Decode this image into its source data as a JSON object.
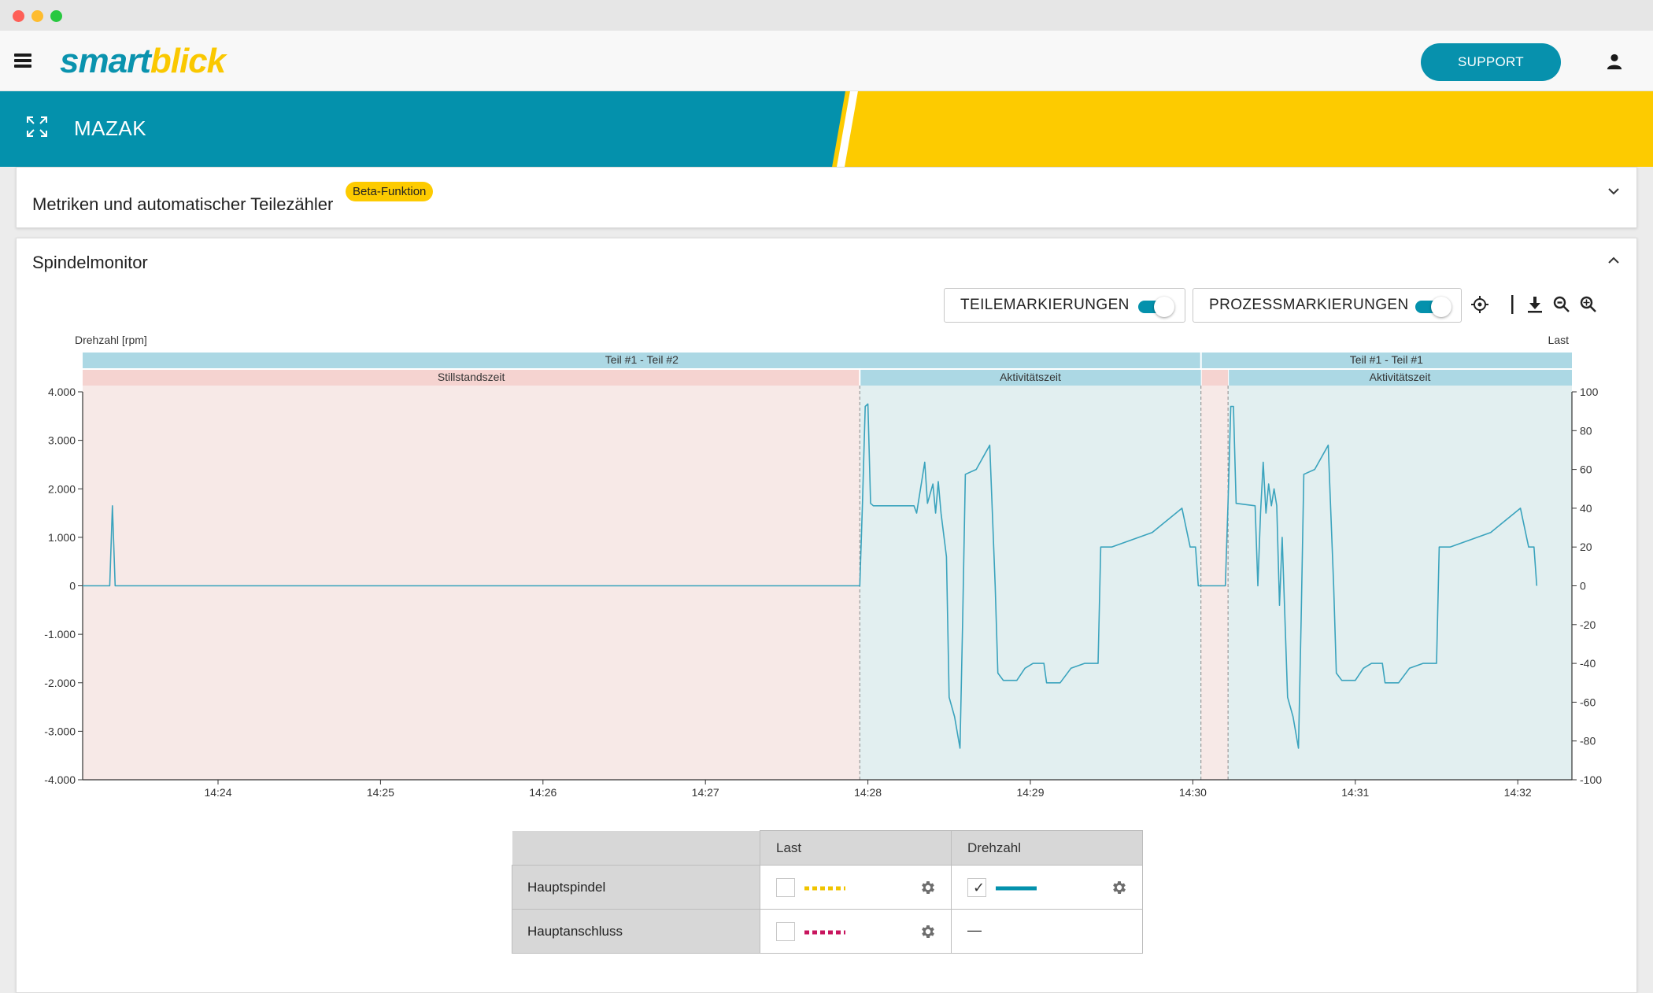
{
  "app": {
    "logo_part1": "smart",
    "logo_part2": "blick",
    "support_label": "SUPPORT",
    "machine_name": "MAZAK"
  },
  "metrics_card": {
    "title": "Metriken und automatischer Teilezähler",
    "badge": "Beta-Funktion"
  },
  "spindle_card": {
    "title": "Spindelmonitor",
    "toggle_parts": "TEILEMARKIERUNGEN",
    "toggle_process": "PROZESSMARKIERUNGEN"
  },
  "colors": {
    "teal": "#0491ac",
    "yellow": "#fdcb00",
    "idle_fill": "#f7e9e7",
    "active_fill": "#e2eff0",
    "part_band": "#acd8e4",
    "idle_band": "#f5d3d0",
    "series_line": "#3aa3bd",
    "load_main": "#f0c400",
    "load_conn": "#c8155e"
  },
  "chart_data": {
    "type": "line",
    "ylabel_left": "Drehzahl [rpm]",
    "ylabel_right": "Last",
    "y_left_ticks": [
      "4.000",
      "3.000",
      "2.000",
      "1.000",
      "0",
      "-1.000",
      "-2.000",
      "-3.000",
      "-4.000"
    ],
    "y_right_ticks": [
      "100",
      "80",
      "60",
      "40",
      "20",
      "0",
      "-20",
      "-40",
      "-60",
      "-80",
      "-100"
    ],
    "ylim_left": [
      -4000,
      4000
    ],
    "ylim_right": [
      -100,
      100
    ],
    "xlim": [
      "14:23:10",
      "14:32:20"
    ],
    "x_ticks": [
      "14:24",
      "14:25",
      "14:26",
      "14:27",
      "14:28",
      "14:29",
      "14:30",
      "14:31",
      "14:32"
    ],
    "part_bands": [
      {
        "label": "Teil #1 - Teil #2",
        "start": "14:23:10",
        "end": "14:30:03"
      },
      {
        "label": "Teil #1 - Teil #1",
        "start": "14:30:03",
        "end": "14:32:20"
      }
    ],
    "state_bands": [
      {
        "label": "Stillstandszeit",
        "state": "idle",
        "start": "14:23:10",
        "end": "14:27:57"
      },
      {
        "label": "Aktivitätszeit",
        "state": "active",
        "start": "14:27:57",
        "end": "14:30:03"
      },
      {
        "label": "",
        "state": "idle",
        "start": "14:30:03",
        "end": "14:30:13"
      },
      {
        "label": "Aktivitätszeit",
        "state": "active",
        "start": "14:30:13",
        "end": "14:32:20"
      }
    ],
    "series": [
      {
        "name": "Hauptspindel Drehzahl",
        "points": [
          [
            "14:23:10",
            0
          ],
          [
            "14:23:20",
            0
          ],
          [
            "14:23:21",
            1650
          ],
          [
            "14:23:22",
            0
          ],
          [
            "14:27:57",
            0
          ],
          [
            "14:27:58",
            1700
          ],
          [
            "14:27:59",
            3700
          ],
          [
            "14:28:00",
            3750
          ],
          [
            "14:28:01",
            1700
          ],
          [
            "14:28:02",
            1650
          ],
          [
            "14:28:17",
            1650
          ],
          [
            "14:28:18",
            1500
          ],
          [
            "14:28:20",
            2200
          ],
          [
            "14:28:21",
            2550
          ],
          [
            "14:28:22",
            1700
          ],
          [
            "14:28:24",
            2100
          ],
          [
            "14:28:25",
            1500
          ],
          [
            "14:28:26",
            2150
          ],
          [
            "14:28:27",
            1500
          ],
          [
            "14:28:29",
            600
          ],
          [
            "14:28:30",
            -2300
          ],
          [
            "14:28:32",
            -2700
          ],
          [
            "14:28:34",
            -3350
          ],
          [
            "14:28:35",
            -700
          ],
          [
            "14:28:36",
            2300
          ],
          [
            "14:28:40",
            2400
          ],
          [
            "14:28:45",
            2900
          ],
          [
            "14:28:47",
            0
          ],
          [
            "14:28:48",
            -1800
          ],
          [
            "14:28:50",
            -1950
          ],
          [
            "14:28:55",
            -1950
          ],
          [
            "14:28:58",
            -1700
          ],
          [
            "14:29:01",
            -1600
          ],
          [
            "14:29:05",
            -1600
          ],
          [
            "14:29:06",
            -2000
          ],
          [
            "14:29:11",
            -2000
          ],
          [
            "14:29:15",
            -1700
          ],
          [
            "14:29:20",
            -1600
          ],
          [
            "14:29:25",
            -1600
          ],
          [
            "14:29:26",
            800
          ],
          [
            "14:29:30",
            800
          ],
          [
            "14:29:45",
            1100
          ],
          [
            "14:29:56",
            1600
          ],
          [
            "14:29:59",
            800
          ],
          [
            "14:30:01",
            800
          ],
          [
            "14:30:02",
            0
          ],
          [
            "14:30:12",
            0
          ],
          [
            "14:30:13",
            1700
          ],
          [
            "14:30:14",
            3700
          ],
          [
            "14:30:15",
            3700
          ],
          [
            "14:30:16",
            1700
          ],
          [
            "14:30:23",
            1650
          ],
          [
            "14:30:24",
            0
          ],
          [
            "14:30:25",
            1500
          ],
          [
            "14:30:26",
            2550
          ],
          [
            "14:30:27",
            1500
          ],
          [
            "14:30:28",
            2100
          ],
          [
            "14:30:29",
            1650
          ],
          [
            "14:30:30",
            2000
          ],
          [
            "14:30:31",
            1650
          ],
          [
            "14:30:32",
            -400
          ],
          [
            "14:30:33",
            1000
          ],
          [
            "14:30:35",
            -2300
          ],
          [
            "14:30:37",
            -2700
          ],
          [
            "14:30:39",
            -3350
          ],
          [
            "14:30:40",
            -700
          ],
          [
            "14:30:41",
            2300
          ],
          [
            "14:30:45",
            2400
          ],
          [
            "14:30:50",
            2900
          ],
          [
            "14:30:52",
            0
          ],
          [
            "14:30:53",
            -1800
          ],
          [
            "14:30:55",
            -1950
          ],
          [
            "14:31:00",
            -1950
          ],
          [
            "14:31:03",
            -1700
          ],
          [
            "14:31:06",
            -1600
          ],
          [
            "14:31:10",
            -1600
          ],
          [
            "14:31:11",
            -2000
          ],
          [
            "14:31:16",
            -2000
          ],
          [
            "14:31:20",
            -1700
          ],
          [
            "14:31:25",
            -1600
          ],
          [
            "14:31:30",
            -1600
          ],
          [
            "14:31:31",
            800
          ],
          [
            "14:31:35",
            800
          ],
          [
            "14:31:50",
            1100
          ],
          [
            "14:32:01",
            1600
          ],
          [
            "14:32:04",
            800
          ],
          [
            "14:32:06",
            800
          ],
          [
            "14:32:07",
            0
          ]
        ]
      }
    ]
  },
  "legend_table": {
    "col_last": "Last",
    "col_drehzahl": "Drehzahl",
    "row1": "Hauptspindel",
    "row2": "Hauptanschluss",
    "row1_last_checked": false,
    "row1_drehzahl_checked": true,
    "row2_last_checked": false,
    "row2_drehzahl_value": "—",
    "check_mark": "✓"
  }
}
